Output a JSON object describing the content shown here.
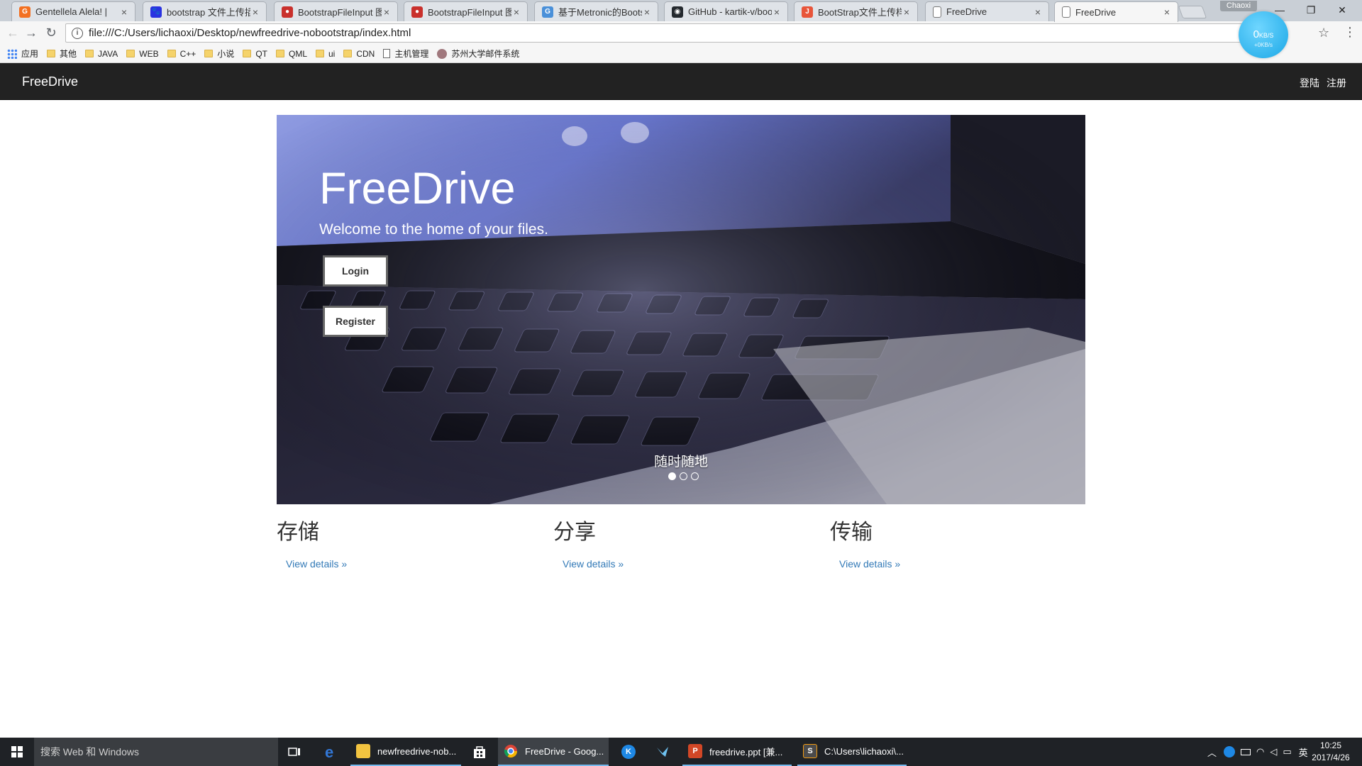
{
  "browser": {
    "tabs": [
      {
        "title": "Gentellela Alela! |",
        "favicon_color": "#f37021",
        "favicon": "G"
      },
      {
        "title": "bootstrap 文件上传插",
        "favicon_color": "#2932e1",
        "favicon": "🐾"
      },
      {
        "title": "BootstrapFileInput 图",
        "favicon_color": "#c9302c",
        "favicon": "●"
      },
      {
        "title": "BootstrapFileInput 图",
        "favicon_color": "#c9302c",
        "favicon": "●"
      },
      {
        "title": "基于Metronic的Boots",
        "favicon_color": "#4a90d9",
        "favicon": "G"
      },
      {
        "title": "GitHub - kartik-v/boo",
        "favicon_color": "#24292e",
        "favicon": "◉"
      },
      {
        "title": "BootStrap文件上传样",
        "favicon_color": "#e8553a",
        "favicon": "J"
      },
      {
        "title": "FreeDrive",
        "favicon_color": "#ffffff",
        "favicon": ""
      },
      {
        "title": "FreeDrive",
        "favicon_color": "#ffffff",
        "favicon": ""
      }
    ],
    "tab_close_glyph": "×",
    "user_name": "Chaoxi",
    "window_controls": {
      "minimize": "—",
      "restore": "❐",
      "close": "✕"
    },
    "address": "file:///C:/Users/lichaoxi/Desktop/newfreedrive-nobootstrap/index.html",
    "nav_glyphs": {
      "back": "←",
      "forward": "→",
      "reload": "↻",
      "info": "i",
      "star": "☆",
      "menu": "⋮"
    },
    "speed": {
      "value": "0",
      "unit": "KB/S",
      "sub": "+0KB/s"
    },
    "bookmarks": [
      {
        "label": "应用",
        "icon": "apps-icon"
      },
      {
        "label": "其他",
        "icon": "folder-icon"
      },
      {
        "label": "JAVA",
        "icon": "folder-icon"
      },
      {
        "label": "WEB",
        "icon": "folder-icon"
      },
      {
        "label": "C++",
        "icon": "folder-icon"
      },
      {
        "label": "小说",
        "icon": "folder-icon"
      },
      {
        "label": "QT",
        "icon": "folder-icon"
      },
      {
        "label": "QML",
        "icon": "folder-icon"
      },
      {
        "label": "ui",
        "icon": "folder-icon"
      },
      {
        "label": "CDN",
        "icon": "folder-icon"
      },
      {
        "label": "主机管理",
        "icon": "page-icon"
      },
      {
        "label": "苏州大学邮件系统",
        "icon": "seal-icon"
      }
    ]
  },
  "site": {
    "brand": "FreeDrive",
    "nav": {
      "login": "登陆",
      "register": "注册"
    },
    "hero": {
      "title": "FreeDrive",
      "subtitle": "Welcome to the home of your files.",
      "login_button": "Login",
      "register_button": "Register",
      "caption": "随时随地",
      "slides": 3,
      "active_slide": 1
    },
    "features": [
      {
        "heading": "存储",
        "link": "View details »"
      },
      {
        "heading": "分享",
        "link": "View details »"
      },
      {
        "heading": "传输",
        "link": "View details »"
      }
    ],
    "colors": {
      "navbar": "#222222",
      "link": "#337ab7",
      "text": "#333333"
    }
  },
  "taskbar": {
    "search_placeholder": "搜索 Web 和 Windows",
    "items": [
      {
        "label": "newfreedrive-nob...",
        "icon": "file-explorer-icon",
        "color": "#f3c440"
      },
      {
        "label": "FreeDrive - Goog...",
        "icon": "chrome-icon",
        "color": "#db4437"
      },
      {
        "label": "freedrive.ppt [兼...",
        "icon": "powerpoint-icon",
        "color": "#d24726"
      },
      {
        "label": "C:\\Users\\lichaoxi\\...",
        "icon": "sublime-icon",
        "color": "#4b4b4b"
      }
    ],
    "ime": "英",
    "time": "10:25",
    "date": "2017/4/26"
  }
}
